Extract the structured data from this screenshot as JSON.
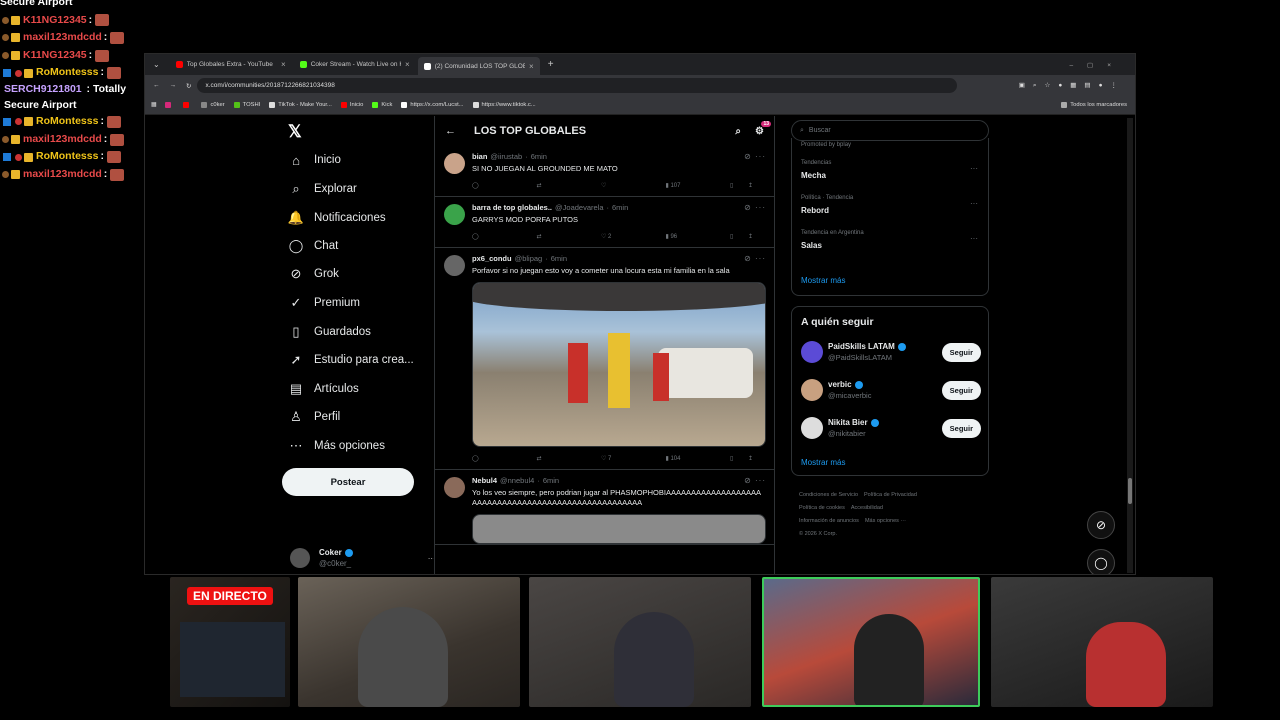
{
  "chat": [
    {
      "user": "K11NG12345",
      "color": "#e84a4a"
    },
    {
      "user": "maxil123mdcdd",
      "color": "#e84a4a"
    },
    {
      "user": "K11NG12345",
      "color": "#e84a4a"
    },
    {
      "user": "RoMontesss",
      "color": "#f0c419"
    },
    {
      "user": "SERCH9121801",
      "color": "#c6a2ff",
      "message": "Totally Secure Airport"
    },
    {
      "user": "RoMontesss",
      "color": "#f0c419"
    },
    {
      "user": "maxil123mdcdd",
      "color": "#e84a4a"
    },
    {
      "user": "RoMontesss",
      "color": "#f0c419"
    },
    {
      "user": "maxil123mdcdd",
      "color": "#e84a4a"
    }
  ],
  "chat_top_fragment": "Secure Airport",
  "browser": {
    "tabs": [
      {
        "title": "Top Globales Extra - YouTube",
        "color": "#ff0000"
      },
      {
        "title": "Coker Stream - Watch Live on K",
        "color": "#53fc18"
      },
      {
        "title": "(2) Comunidad LOS TOP GLOB",
        "color": "#ffffff"
      }
    ],
    "url": "x.com/i/communities/2018712266821034398",
    "bookmarks": [
      "c0ker",
      "TOSHI",
      "TikTok - Make Your...",
      "Inicio",
      "Kick",
      "https://x.com/Lucst...",
      "https://www.tiktok.c..."
    ],
    "bookmarks_right": "Todos los marcadores"
  },
  "nav": {
    "items": [
      {
        "label": "Inicio",
        "icon": "⌂"
      },
      {
        "label": "Explorar",
        "icon": "⌕"
      },
      {
        "label": "Notificaciones",
        "icon": "🔔"
      },
      {
        "label": "Chat",
        "icon": "◯"
      },
      {
        "label": "Grok",
        "icon": "⊘"
      },
      {
        "label": "Premium",
        "icon": "✓"
      },
      {
        "label": "Guardados",
        "icon": "▯"
      },
      {
        "label": "Estudio para crea...",
        "icon": "➚"
      },
      {
        "label": "Artículos",
        "icon": "▤"
      },
      {
        "label": "Perfil",
        "icon": "♙"
      },
      {
        "label": "Más opciones",
        "icon": "⋯"
      }
    ],
    "post_label": "Postear",
    "profile_name": "Coker",
    "profile_handle": "@c0ker_",
    "notif_badge": "2"
  },
  "feed": {
    "title": "LOS TOP GLOBALES",
    "badge": "13",
    "tweets": [
      {
        "name": "bian",
        "handle": "@iirustab",
        "time": "6min",
        "text": "SI NO JUEGAN AL GROUNDED ME MATO",
        "likes": "",
        "views": "107",
        "avatar": "#c9a38a"
      },
      {
        "name": "barra de top globales..",
        "handle": "@Joadevarela",
        "time": "6min",
        "text": "GARRYS MOD PORFA PUTOS",
        "likes": "2",
        "views": "96",
        "avatar": "#3aa34a"
      },
      {
        "name": "px6_condu",
        "handle": "@blipag",
        "time": "6min",
        "text": "Porfavor si no juegan esto voy a cometer una locura esta mi familia en la sala",
        "likes": "7",
        "views": "104",
        "avatar": "#666"
      },
      {
        "name": "Nebul4",
        "handle": "@nnebul4",
        "time": "6min",
        "text": "Yo los veo siempre, pero podrian jugar al PHASMOPHOBIAAAAAAAAAAAAAAAAAAAAAAAAAAAAAAAAAAAAAAAAAAAAAAAAAAAAA",
        "likes": "",
        "views": "",
        "avatar": "#8a6a5a"
      }
    ]
  },
  "right": {
    "search_placeholder": "Buscar",
    "promoted": "Promoted by bplay",
    "trends": [
      {
        "cat": "Tendencias",
        "name": "Mecha"
      },
      {
        "cat": "Política · Tendencia",
        "name": "Rebord"
      },
      {
        "cat": "Tendencia en Argentina",
        "name": "Salas"
      }
    ],
    "show_more": "Mostrar más",
    "who_title": "A quién seguir",
    "who": [
      {
        "name": "PaidSkills LATAM",
        "handle": "@PaidSkillsLATAM",
        "avatar": "#5b4bd6"
      },
      {
        "name": "verbic",
        "handle": "@micaverbic",
        "avatar": "#c8a080"
      },
      {
        "name": "Nikita Bier",
        "handle": "@nikitabier",
        "avatar": "#ddd"
      }
    ],
    "follow_label": "Seguir",
    "footer": [
      "Condiciones de Servicio",
      "Política de Privacidad",
      "Política de cookies",
      "Accesibilidad",
      "Información de anuncios",
      "Más opciones ···",
      "© 2026 X Corp."
    ]
  },
  "live_label": "EN DIRECTO"
}
